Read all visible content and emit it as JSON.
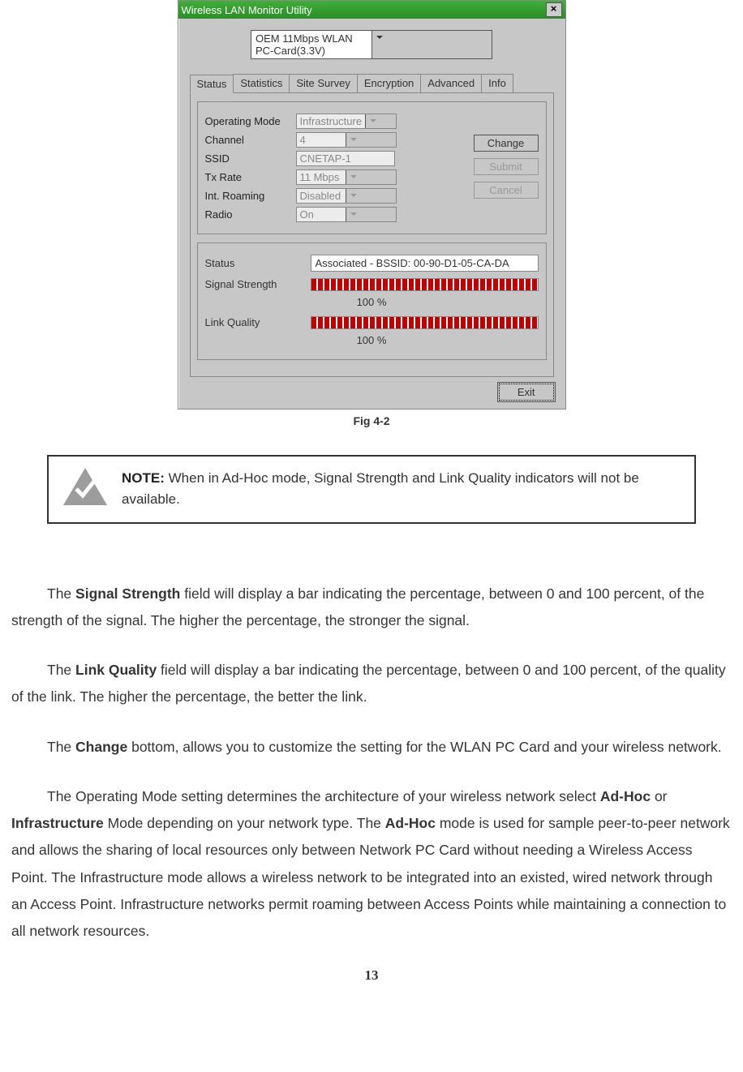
{
  "dialog": {
    "title": "Wireless LAN Monitor Utility",
    "cardSelector": "OEM 11Mbps WLAN PC-Card(3.3V)",
    "tabs": [
      "Status",
      "Statistics",
      "Site Survey",
      "Encryption",
      "Advanced",
      "Info"
    ],
    "fields": {
      "operatingMode": {
        "label": "Operating Mode",
        "value": "Infrastructure"
      },
      "channel": {
        "label": "Channel",
        "value": "4"
      },
      "ssid": {
        "label": "SSID",
        "value": "CNETAP-1"
      },
      "txRate": {
        "label": "Tx Rate",
        "value": "11 Mbps"
      },
      "intRoaming": {
        "label": "Int. Roaming",
        "value": "Disabled"
      },
      "radio": {
        "label": "Radio",
        "value": "On"
      }
    },
    "buttons": {
      "change": "Change",
      "submit": "Submit",
      "cancel": "Cancel"
    },
    "statusLabel": "Status",
    "statusValue": "Associated - BSSID: 00-90-D1-05-CA-DA",
    "signal": {
      "label": "Signal Strength",
      "pct": "100 %"
    },
    "link": {
      "label": "Link Quality",
      "pct": "100 %"
    },
    "exit": "Exit"
  },
  "caption": "Fig 4-2",
  "note": {
    "label": "NOTE:",
    "text": " When in Ad-Hoc mode, Signal Strength and Link Quality indicators will not be available."
  },
  "para": {
    "p1a": "The ",
    "p1b": "Signal Strength",
    "p1c": " field will display a bar indicating the percentage, between 0 and 100 percent, of the strength of the signal. The higher the percentage, the stronger the signal.",
    "p2a": "The ",
    "p2b": "Link Quality",
    "p2c": " field will display a bar indicating the percentage, between 0 and 100 percent, of the quality of the link. The higher the percentage, the better the link.",
    "p3a": "The ",
    "p3b": "Change",
    "p3c": " bottom, allows you to customize the setting for the WLAN PC Card and your wireless network.",
    "p4a": "The Operating Mode setting determines the architecture of your wireless network select ",
    "p4b": "Ad-Hoc",
    "p4c": " or ",
    "p4d": "Infrastructure",
    "p4e": " Mode depending on your network type. The ",
    "p4f": "Ad-Hoc",
    "p4g": " mode is used for sample peer-to-peer network and allows the sharing of local resources only between Network PC Card without needing a Wireless Access Point. The Infrastructure mode allows a wireless network to be integrated into an existed, wired network through an Access Point. Infrastructure networks permit roaming between Access Points while maintaining a connection to all network resources."
  },
  "pageNumber": "13"
}
